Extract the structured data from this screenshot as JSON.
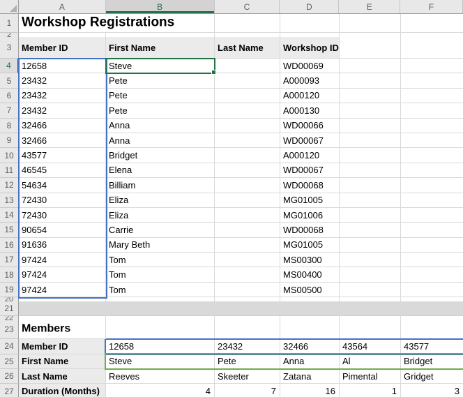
{
  "sheet": {
    "columns": [
      "A",
      "B",
      "C",
      "D",
      "E",
      "F"
    ],
    "row_numbers": [
      "1",
      "2",
      "3",
      "4",
      "5",
      "6",
      "7",
      "8",
      "9",
      "10",
      "11",
      "12",
      "13",
      "14",
      "15",
      "16",
      "17",
      "18",
      "19",
      "20",
      "21",
      "22",
      "23",
      "24",
      "25",
      "26",
      "27"
    ],
    "selected_cell": "B4"
  },
  "registrations": {
    "title": "Workshop Registrations",
    "headers": {
      "member_id": "Member ID",
      "first_name": "First Name",
      "last_name": "Last Name",
      "workshop_id": "Workshop ID"
    },
    "rows": [
      {
        "member_id": "12658",
        "first_name": "Steve",
        "workshop_id": "WD00069"
      },
      {
        "member_id": "23432",
        "first_name": "Pete",
        "workshop_id": "A000093"
      },
      {
        "member_id": "23432",
        "first_name": "Pete",
        "workshop_id": "A000120"
      },
      {
        "member_id": "23432",
        "first_name": "Pete",
        "workshop_id": "A000130"
      },
      {
        "member_id": "32466",
        "first_name": "Anna",
        "workshop_id": "WD00066"
      },
      {
        "member_id": "32466",
        "first_name": "Anna",
        "workshop_id": "WD00067"
      },
      {
        "member_id": "43577",
        "first_name": "Bridget",
        "workshop_id": "A000120"
      },
      {
        "member_id": "46545",
        "first_name": "Elena",
        "workshop_id": "WD00067"
      },
      {
        "member_id": "54634",
        "first_name": "Billiam",
        "workshop_id": "WD00068"
      },
      {
        "member_id": "72430",
        "first_name": "Eliza",
        "workshop_id": "MG01005"
      },
      {
        "member_id": "72430",
        "first_name": "Eliza",
        "workshop_id": "MG01006"
      },
      {
        "member_id": "90654",
        "first_name": "Carrie",
        "workshop_id": "WD00068"
      },
      {
        "member_id": "91636",
        "first_name": "Mary Beth",
        "workshop_id": "MG01005"
      },
      {
        "member_id": "97424",
        "first_name": "Tom",
        "workshop_id": "MS00300"
      },
      {
        "member_id": "97424",
        "first_name": "Tom",
        "workshop_id": "MS00400"
      },
      {
        "member_id": "97424",
        "first_name": "Tom",
        "workshop_id": "MS00500"
      }
    ]
  },
  "members": {
    "title": "Members",
    "labels": {
      "member_id": "Member ID",
      "first_name": "First Name",
      "last_name": "Last Name",
      "duration": "Duration (Months)"
    },
    "member_ids": [
      "12658",
      "23432",
      "32466",
      "43564",
      "43577"
    ],
    "first_names": [
      "Steve",
      "Pete",
      "Anna",
      "Al",
      "Bridget"
    ],
    "last_names": [
      "Reeves",
      "Skeeter",
      "Zatana",
      "Pimental",
      "Gridget"
    ],
    "durations": [
      "4",
      "7",
      "16",
      "1",
      "3"
    ]
  },
  "colors": {
    "range_blue": "#4472c4",
    "range_green": "#70ad47",
    "selection_green": "#217346"
  }
}
